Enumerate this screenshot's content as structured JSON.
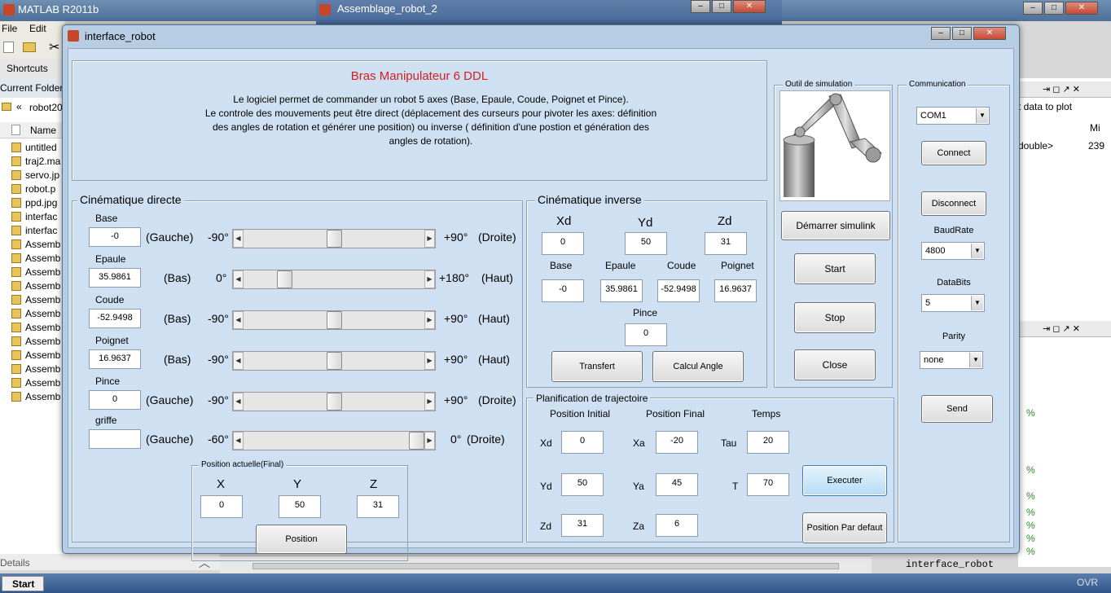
{
  "desktop": {
    "matlab_title": "MATLAB  R2011b",
    "menu": [
      "File",
      "Edit"
    ],
    "shortcuts": "Shortcuts",
    "current_folder": "Current Folder",
    "folder_path": "robot20",
    "files_header": "Name",
    "files": [
      "untitled",
      "traj2.ma",
      "servo.jp",
      "robot.p",
      "ppd.jpg",
      "interfac",
      "interfac",
      "Assemb",
      "Assemb",
      "Assemb",
      "Assemb",
      "Assemb",
      "Assemb",
      "Assemb",
      "Assemb",
      "Assemb",
      "Assemb",
      "Assemb",
      "Assemb"
    ],
    "details": "Details",
    "bg_window_title": "Assemblage_robot_2",
    "right_pane": {
      "data_to_plot": "t data to plot",
      "min_col": "Mi",
      "type_val": "double>",
      "num_val": "239",
      "tree_item": "interface_robot",
      "markers": [
        "%",
        "%",
        "%",
        "%",
        "%",
        "%",
        "%",
        "%"
      ]
    },
    "taskbar_start": "Start",
    "status": "OVR"
  },
  "window": {
    "title": "interface_robot",
    "header": {
      "title": "Bras Manipulateur 6 DDL",
      "lines": [
        "Le logiciel permet de commander un robot 5 axes (Base, Epaule, Coude, Poignet et Pince).",
        "Le controle des mouvements peut être direct (déplacement des curseurs pour pivoter les axes: définition",
        "des angles de rotation et  générer une position) ou inverse ( définition d'une postion et génération des",
        "angles de rotation)."
      ]
    },
    "direct": {
      "title": "Cinématique directe",
      "joints": [
        {
          "name": "Base",
          "value": "-0",
          "left_dir": "(Gauche)",
          "min": "-90°",
          "max": "+90°",
          "right_dir": "(Droite)",
          "slider_fraction": 0.5
        },
        {
          "name": "Epaule",
          "value": "35.9861",
          "left_dir": "(Bas)",
          "min": "0°",
          "max": "+180°",
          "right_dir": "(Haut)",
          "slider_fraction": 0.2
        },
        {
          "name": "Coude",
          "value": "-52.9498",
          "left_dir": "(Bas)",
          "min": "-90°",
          "max": "+90°",
          "right_dir": "(Haut)",
          "slider_fraction": 0.5
        },
        {
          "name": "Poignet",
          "value": "16.9637",
          "left_dir": "(Bas)",
          "min": "-90°",
          "max": "+90°",
          "right_dir": "(Haut)",
          "slider_fraction": 0.5
        },
        {
          "name": "Pince",
          "value": "0",
          "left_dir": "(Gauche)",
          "min": "-90°",
          "max": "+90°",
          "right_dir": "(Droite)",
          "slider_fraction": 0.5
        },
        {
          "name": "griffe",
          "value": "",
          "left_dir": "(Gauche)",
          "min": "-60°",
          "max": "0°",
          "right_dir": "(Droite)",
          "slider_fraction": 1.0
        }
      ],
      "position": {
        "title": "Position actuelle(Final)",
        "x_label": "X",
        "y_label": "Y",
        "z_label": "Z",
        "x": "0",
        "y": "50",
        "z": "31",
        "button": "Position"
      }
    },
    "inverse": {
      "title": "Cinématique inverse",
      "xd_label": "Xd",
      "yd_label": "Yd",
      "zd_label": "Zd",
      "xd": "0",
      "yd": "50",
      "zd": "31",
      "base_label": "Base",
      "epaule_label": "Epaule",
      "coude_label": "Coude",
      "poignet_label": "Poignet",
      "base": "-0",
      "epaule": "35.9861",
      "coude": "-52.9498",
      "poignet": "16.9637",
      "pince_label": "Pince",
      "pince": "0",
      "transfert": "Transfert",
      "calcul": "Calcul Angle"
    },
    "trajectory": {
      "title": "Planification de trajectoire",
      "col_initial": "Position Initial",
      "col_final": "Position Final",
      "col_time": "Temps",
      "xd_label": "Xd",
      "yd_label": "Yd",
      "zd_label": "Zd",
      "xd": "0",
      "yd": "50",
      "zd": "31",
      "xa_label": "Xa",
      "ya_label": "Ya",
      "za_label": "Za",
      "xa": "-20",
      "ya": "45",
      "za": "6",
      "tau_label": "Tau",
      "tau": "20",
      "t_label": "T",
      "t": "70",
      "execute": "Executer",
      "default": "Position Par defaut"
    },
    "simulation": {
      "title": "Outil de simulation",
      "simulink": "Démarrer simulink",
      "start": "Start",
      "stop": "Stop",
      "close": "Close"
    },
    "communication": {
      "title": "Communication",
      "port": "COM1",
      "connect": "Connect",
      "disconnect": "Disconnect",
      "baud_label": "BaudRate",
      "baud": "4800",
      "bits_label": "DataBits",
      "bits": "5",
      "parity_label": "Parity",
      "parity": "none",
      "send": "Send"
    }
  }
}
